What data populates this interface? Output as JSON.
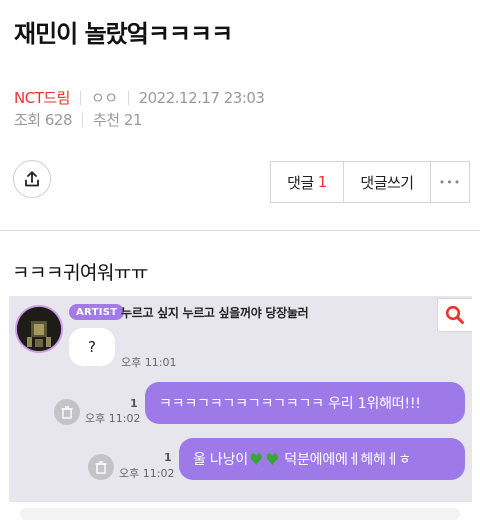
{
  "post": {
    "title": "재민이 놀랐엌ㅋㅋㅋㅋ",
    "board": "NCT드림",
    "author": "ㅇㅇ",
    "datetime": "2022.12.17 23:03",
    "views": "조회 628",
    "recommends": "추천 21",
    "body": "ㅋㅋㅋ귀여워ㅠㅠ"
  },
  "actions": {
    "comment_label": "댓글",
    "comment_count": "1",
    "write_comment_label": "댓글쓰기",
    "more_label": "•••"
  },
  "chat": {
    "badge": "ARTIST",
    "header": "누르고 싶지 누르고 싶을꺼야 당장눌러",
    "messages": [
      {
        "text": "?",
        "time": "오후 11:01"
      },
      {
        "text": "ㅋㅋㅋㄱㅋㄱㅋㄱㅋㄱㅋㄱㅋ 우리 1위해떠!!!",
        "time": "오후 11:02",
        "read": "1"
      },
      {
        "text_a": "울 나낭이",
        "text_b": "덕분에에에ㅔ헤헤ㅔㅎ",
        "time": "오후 11:02",
        "read": "1"
      }
    ]
  },
  "colors": {
    "accent": "#e8352e",
    "bubble": "#9e7ae8",
    "badge": "#a37ae6",
    "chat_bg": "#e7e6ec",
    "heart": "#3aa537"
  },
  "icons": [
    "share-icon",
    "search-icon",
    "trash-icon",
    "green-heart-icon"
  ]
}
